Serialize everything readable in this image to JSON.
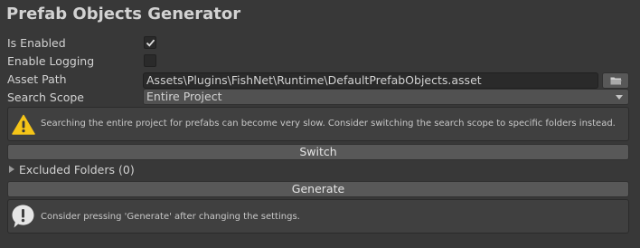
{
  "title": "Prefab Objects Generator",
  "fields": {
    "is_enabled": {
      "label": "Is Enabled",
      "checked": true
    },
    "enable_logging": {
      "label": "Enable Logging",
      "checked": false
    },
    "asset_path": {
      "label": "Asset Path",
      "value": "Assets\\Plugins\\FishNet\\Runtime\\DefaultPrefabObjects.asset"
    },
    "search_scope": {
      "label": "Search Scope",
      "value": "Entire Project"
    }
  },
  "warning": {
    "text": "Searching the entire project for prefabs can become very slow. Consider switching the search scope to specific folders instead.",
    "icon": "warning-icon"
  },
  "switch_button": {
    "label": "Switch"
  },
  "excluded_folders": {
    "label": "Excluded Folders (0)",
    "expanded": false
  },
  "generate_button": {
    "label": "Generate"
  },
  "info": {
    "text": "Consider pressing 'Generate' after changing the settings.",
    "icon": "info-icon"
  },
  "colors": {
    "background": "#383838",
    "warning_yellow": "#f5c518",
    "info_white": "#e6e6e6"
  }
}
